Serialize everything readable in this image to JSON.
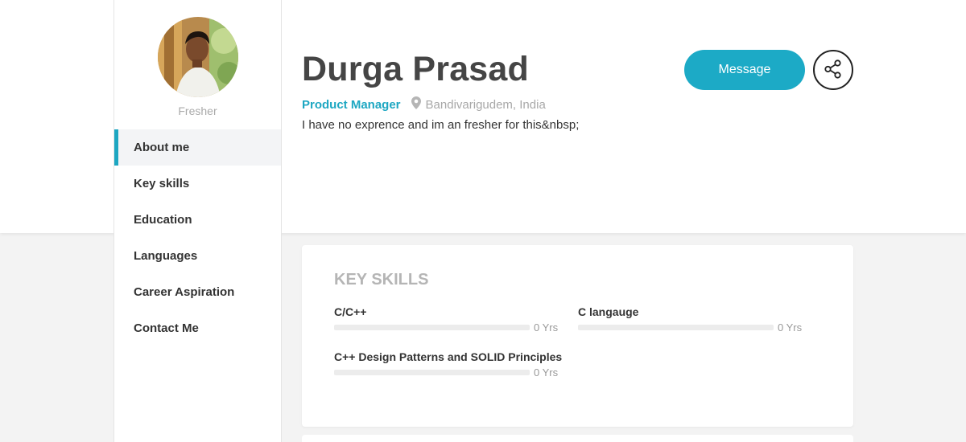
{
  "profile": {
    "name": "Durga Prasad",
    "status": "Fresher",
    "role": "Product Manager",
    "location": "Bandivarigudem, India",
    "bio": "I have no exprence and im an fresher for this&nbsp;"
  },
  "actions": {
    "message_label": "Message",
    "share_icon": "share-icon"
  },
  "nav": {
    "items": [
      {
        "label": "About me",
        "active": true
      },
      {
        "label": "Key skills",
        "active": false
      },
      {
        "label": "Education",
        "active": false
      },
      {
        "label": "Languages",
        "active": false
      },
      {
        "label": "Career Aspiration",
        "active": false
      },
      {
        "label": "Contact Me",
        "active": false
      }
    ]
  },
  "skills": {
    "title": "KEY SKILLS",
    "items": [
      {
        "name": "C/C++",
        "years": "0 Yrs",
        "level": 0
      },
      {
        "name": "C langauge",
        "years": "0 Yrs",
        "level": 0
      },
      {
        "name": "C++ Design Patterns and SOLID Principles",
        "years": "0 Yrs",
        "level": 0
      }
    ]
  },
  "colors": {
    "accent": "#1da7c2",
    "button": "#1caac6",
    "muted": "#a8a8a8"
  }
}
